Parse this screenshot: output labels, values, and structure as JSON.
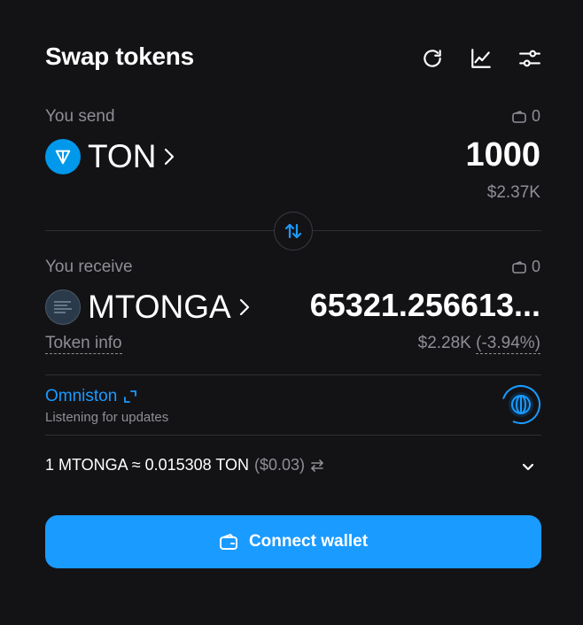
{
  "header": {
    "title": "Swap tokens",
    "icons": [
      "refresh-icon",
      "chart-icon",
      "settings-sliders-icon"
    ]
  },
  "send": {
    "label": "You send",
    "balance": "0",
    "token": "TON",
    "amount": "1000",
    "usd": "$2.37K"
  },
  "receive": {
    "label": "You receive",
    "balance": "0",
    "token": "MTONGA",
    "amount": "65321.256613...",
    "token_info": "Token info",
    "usd": "$2.28K",
    "change": "(-3.94%)"
  },
  "omniston": {
    "name": "Omniston",
    "status": "Listening for updates"
  },
  "rate": {
    "text": "1 MTONGA ≈ 0.015308 TON",
    "usd": "($0.03)"
  },
  "connect": {
    "label": "Connect wallet"
  },
  "colors": {
    "accent": "#1a9bff",
    "background": "#131316",
    "muted": "#8e8e96"
  }
}
